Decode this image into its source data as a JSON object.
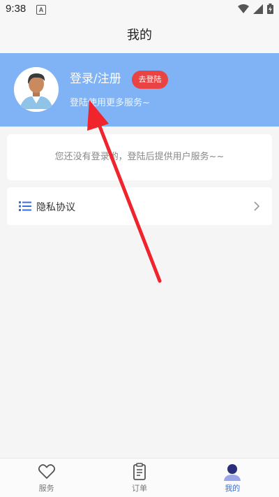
{
  "status_bar": {
    "time": "9:38",
    "notification_letter": "A",
    "icons": [
      "wifi-icon",
      "signal-icon",
      "battery-icon"
    ]
  },
  "header": {
    "title": "我的"
  },
  "profile": {
    "login_title": "登录/注册",
    "go_login_label": "去登陆",
    "subtitle": "登陆使用更多服务~",
    "colors": {
      "banner": "#7fb3f5",
      "button": "#e94343"
    }
  },
  "notice": {
    "text": "您还没有登录哟，登陆后提供用户服务~~"
  },
  "menu": {
    "items": [
      {
        "label": "隐私协议",
        "icon": "list-icon"
      }
    ]
  },
  "tabs": [
    {
      "label": "服务",
      "icon": "heart-icon",
      "active": false
    },
    {
      "label": "订单",
      "icon": "order-icon",
      "active": false
    },
    {
      "label": "我的",
      "icon": "person-icon",
      "active": true
    }
  ],
  "annotation": {
    "color": "#f0242c"
  }
}
